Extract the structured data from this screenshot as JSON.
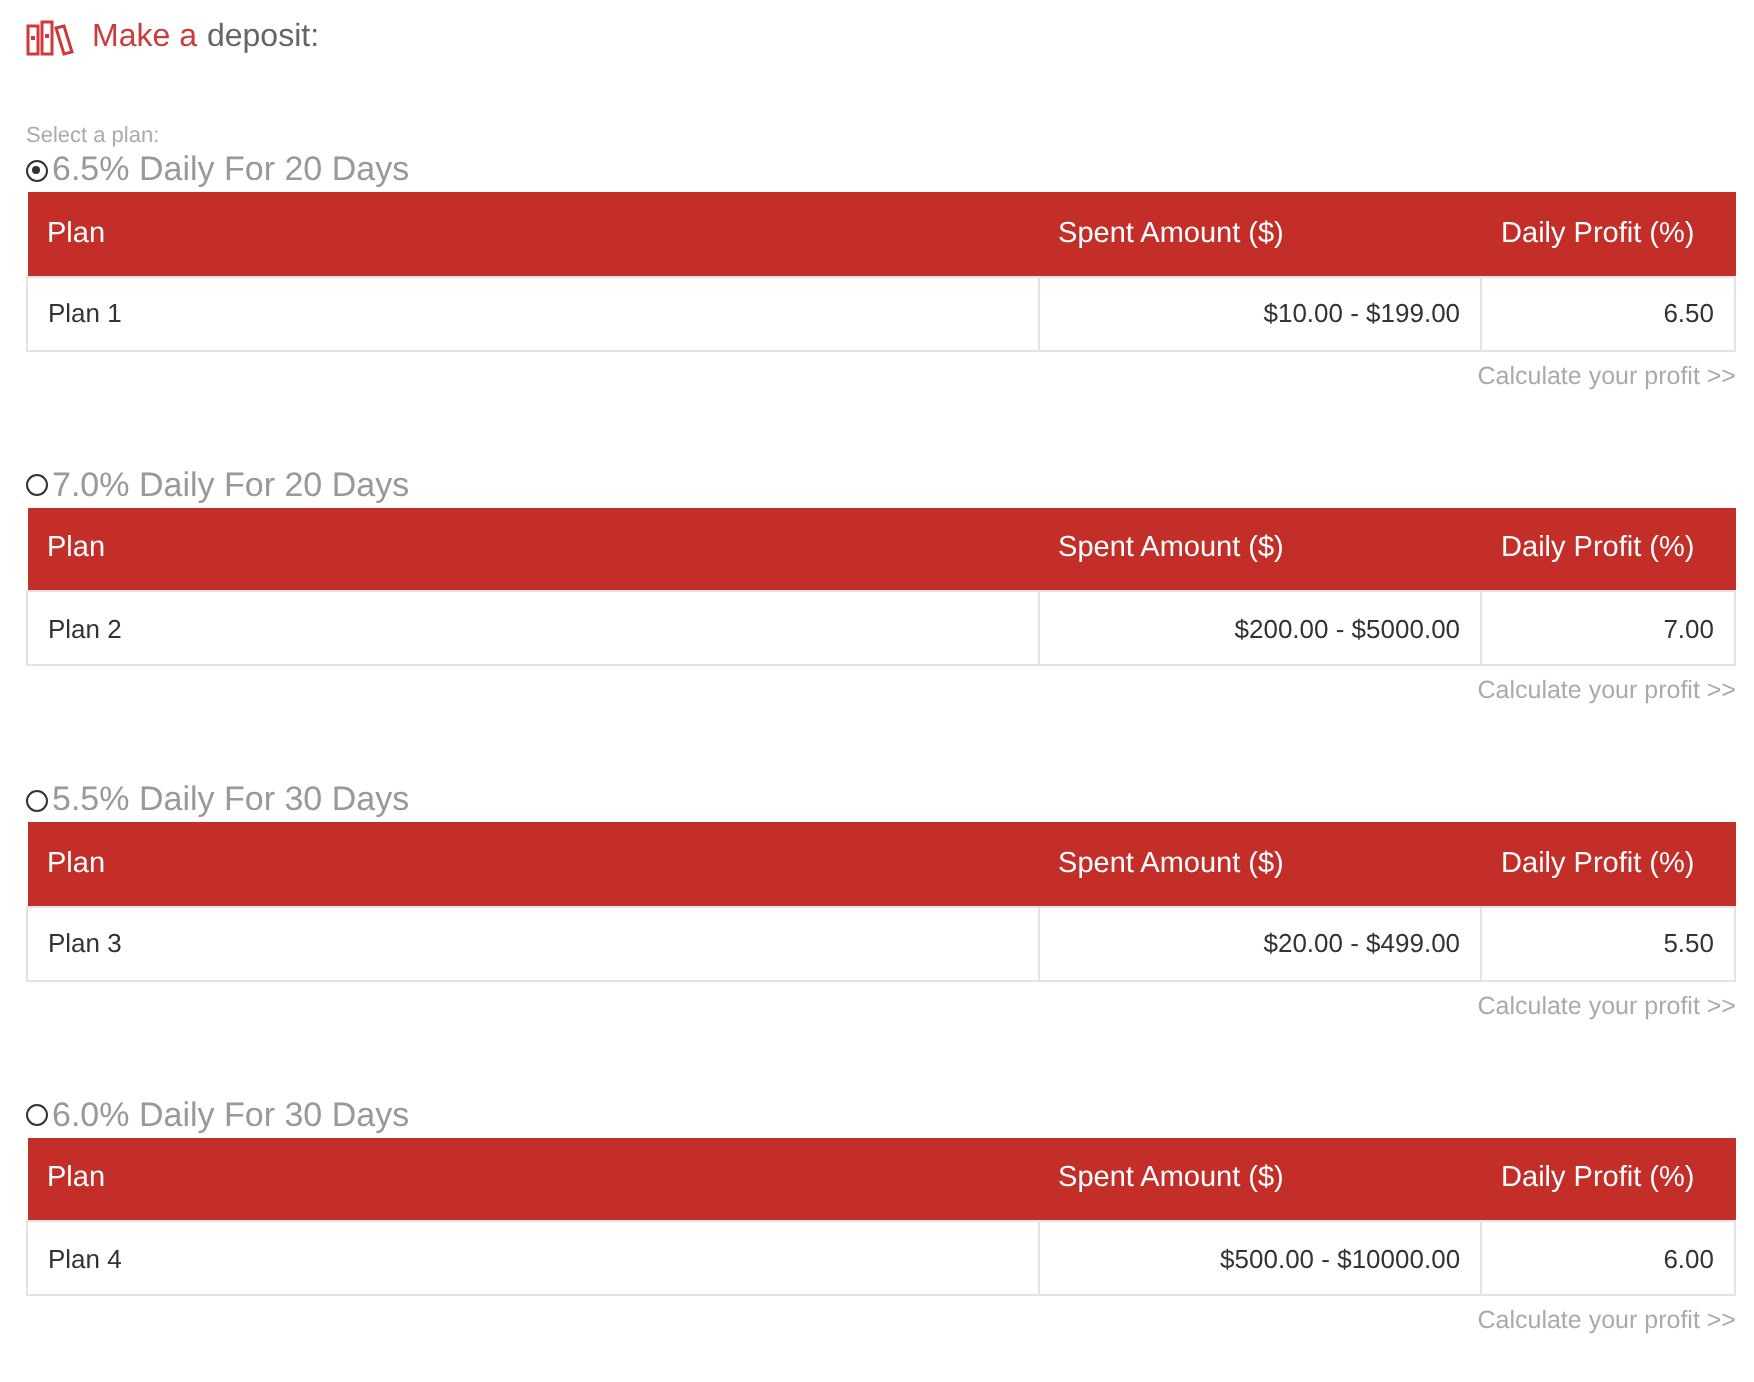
{
  "heading": {
    "accent": "Make a",
    "rest": "deposit:"
  },
  "select_label": "Select a plan:",
  "plans": [
    {
      "title": "6.5% Daily For 20 Days",
      "selected": true,
      "columns": [
        "Plan",
        "Spent Amount ($)",
        "Daily Profit (%)"
      ],
      "name": "Plan 1",
      "amount": "$10.00 - $199.00",
      "profit": "6.50",
      "link": "Calculate your profit >>"
    },
    {
      "title": "7.0% Daily For 20 Days",
      "selected": false,
      "columns": [
        "Plan",
        "Spent Amount ($)",
        "Daily Profit (%)"
      ],
      "name": "Plan 2",
      "amount": "$200.00 - $5000.00",
      "profit": "7.00",
      "link": "Calculate your profit >>"
    },
    {
      "title": "5.5% Daily For 30 Days",
      "selected": false,
      "columns": [
        "Plan",
        "Spent Amount ($)",
        "Daily Profit (%)"
      ],
      "name": "Plan 3",
      "amount": "$20.00 - $499.00",
      "profit": "5.50",
      "link": "Calculate your profit >>"
    },
    {
      "title": "6.0% Daily For 30 Days",
      "selected": false,
      "columns": [
        "Plan",
        "Spent Amount ($)",
        "Daily Profit (%)"
      ],
      "name": "Plan 4",
      "amount": "$500.00 - $10000.00",
      "profit": "6.00",
      "link": "Calculate your profit >>"
    }
  ]
}
